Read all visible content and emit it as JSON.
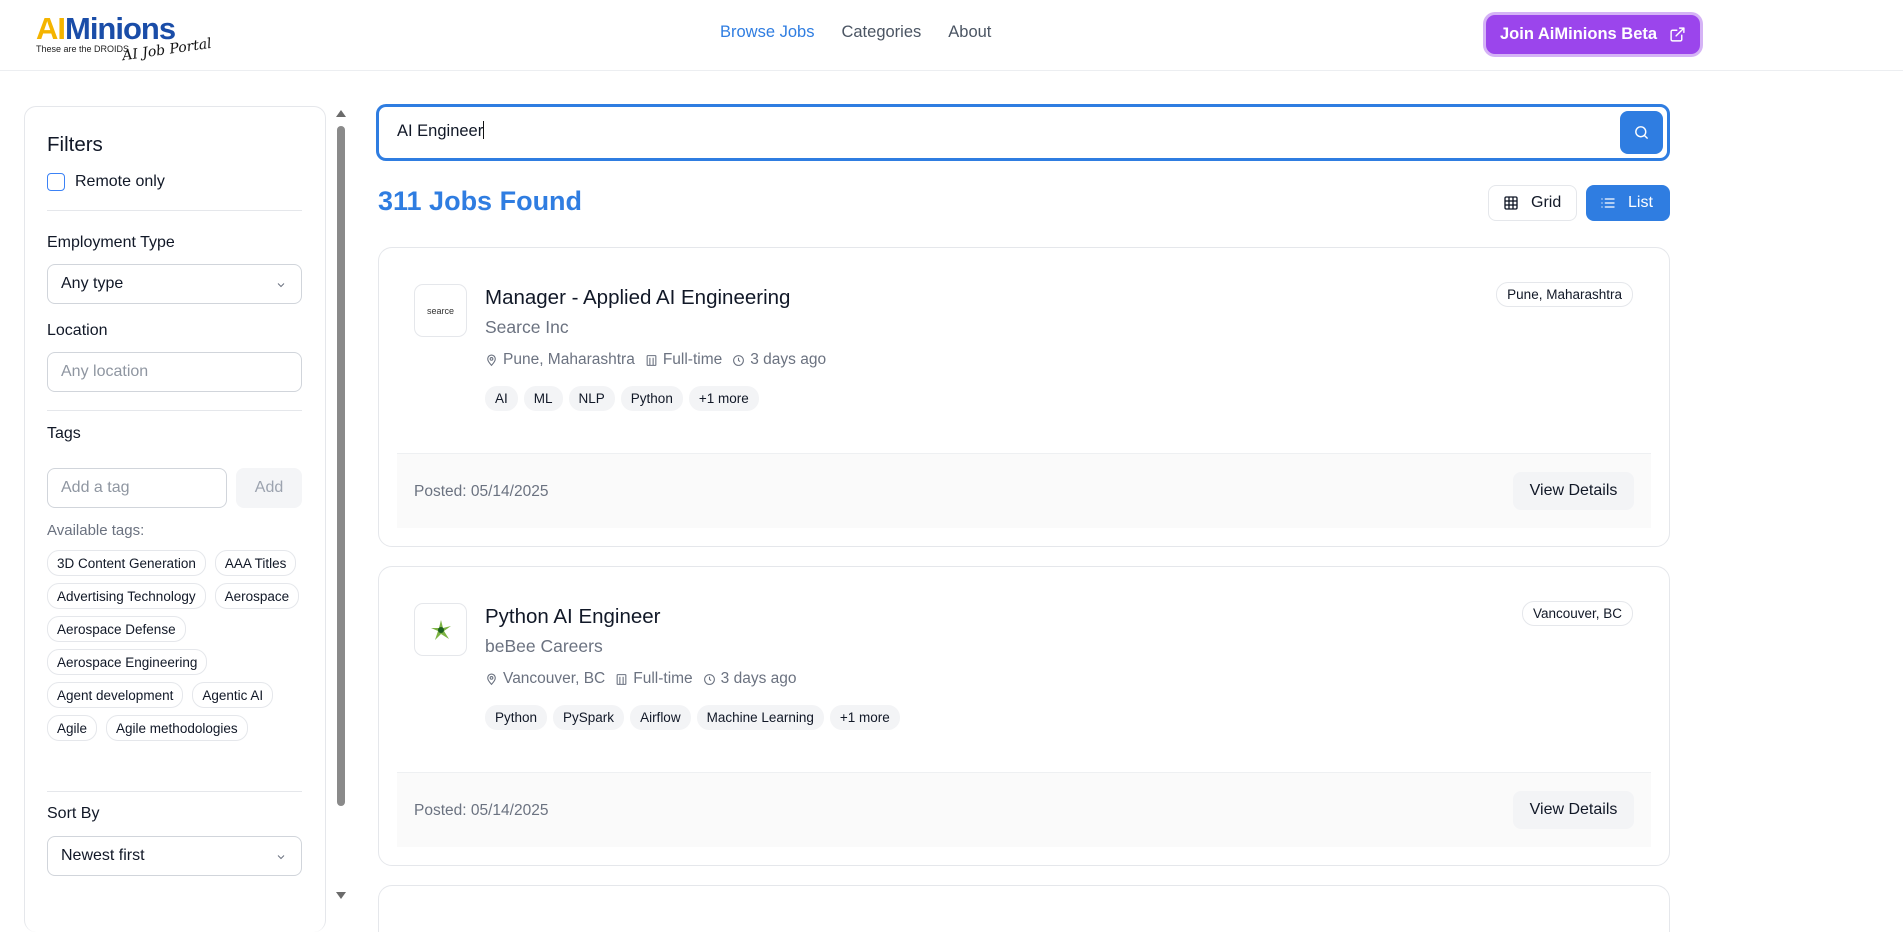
{
  "header": {
    "logo": {
      "ai": "AI",
      "minions": "Minions",
      "tagline": "These are the DROIDS",
      "script": "AI Job Portal"
    },
    "nav": [
      {
        "label": "Browse Jobs",
        "active": true
      },
      {
        "label": "Categories",
        "active": false
      },
      {
        "label": "About",
        "active": false
      }
    ],
    "beta_button": "Join AiMinions Beta"
  },
  "filters": {
    "title": "Filters",
    "remote_only": {
      "label": "Remote only",
      "checked": false
    },
    "employment_type": {
      "label": "Employment Type",
      "value": "Any type"
    },
    "location": {
      "label": "Location",
      "placeholder": "Any location"
    },
    "tags": {
      "label": "Tags",
      "placeholder": "Add a tag",
      "add_label": "Add",
      "available_label": "Available tags:",
      "available": [
        "3D Content Generation",
        "AAA Titles",
        "Advertising Technology",
        "Aerospace",
        "Aerospace Defense",
        "Aerospace Engineering",
        "Agent development",
        "Agentic AI",
        "Agile",
        "Agile methodologies"
      ]
    },
    "sort": {
      "label": "Sort By",
      "value": "Newest first"
    }
  },
  "search": {
    "value": "AI Engineer"
  },
  "results": {
    "count_label": "311 Jobs Found",
    "view": {
      "grid": "Grid",
      "list": "List",
      "active": "list"
    }
  },
  "jobs": [
    {
      "title": "Manager - Applied AI Engineering",
      "company": "Searce Inc",
      "logo_text": "searce",
      "location": "Pune, Maharashtra",
      "type": "Full-time",
      "age": "3 days ago",
      "tags": [
        "AI",
        "ML",
        "NLP",
        "Python",
        "+1 more"
      ],
      "badge": "Pune, Maharashtra",
      "posted": "Posted: 05/14/2025",
      "action": "View Details"
    },
    {
      "title": "Python AI Engineer",
      "company": "beBee Careers",
      "logo_text": "",
      "location": "Vancouver, BC",
      "type": "Full-time",
      "age": "3 days ago",
      "tags": [
        "Python",
        "PySpark",
        "Airflow",
        "Machine Learning",
        "+1 more"
      ],
      "badge": "Vancouver, BC",
      "posted": "Posted: 05/14/2025",
      "action": "View Details"
    }
  ],
  "colors": {
    "accent": "#2f7de1",
    "beta": "#9b45ec",
    "logo_yellow": "#f4b400",
    "logo_blue": "#1a4da8"
  }
}
